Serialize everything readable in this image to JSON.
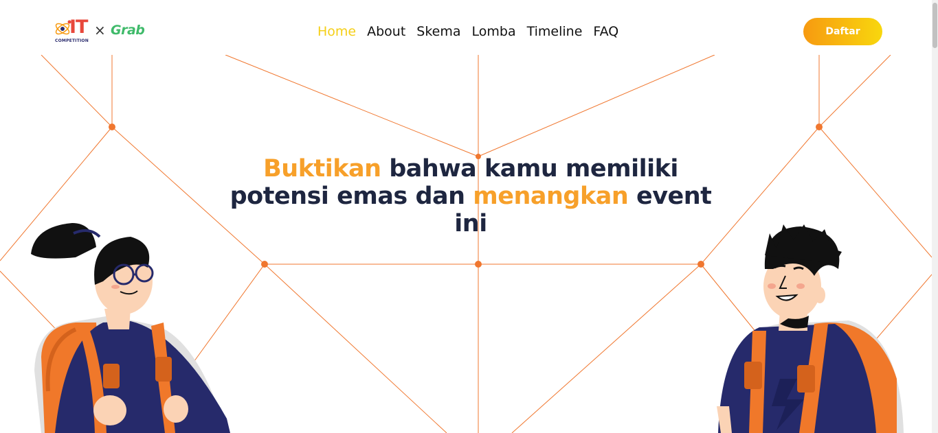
{
  "brand": {
    "logo_main": "IT",
    "logo_sub": "COMPETITION",
    "times": "×",
    "partner": "Grab"
  },
  "nav": {
    "items": [
      {
        "label": "Home",
        "active": true
      },
      {
        "label": "About"
      },
      {
        "label": "Skema"
      },
      {
        "label": "Lomba"
      },
      {
        "label": "Timeline"
      },
      {
        "label": "FAQ"
      }
    ]
  },
  "cta": {
    "label": "Daftar"
  },
  "hero": {
    "part1": "Buktikan",
    "part2": " bahwa kamu memiliki potensi emas dan ",
    "part3": "menangkan",
    "part4": " event ini"
  },
  "colors": {
    "accent": "#f7a02a",
    "nav_active": "#f5cf18",
    "line": "#f0772f",
    "dark_text": "#1e2640"
  },
  "icons": [
    "atom-logo-icon",
    "girl-student-illustration",
    "boy-student-illustration"
  ]
}
